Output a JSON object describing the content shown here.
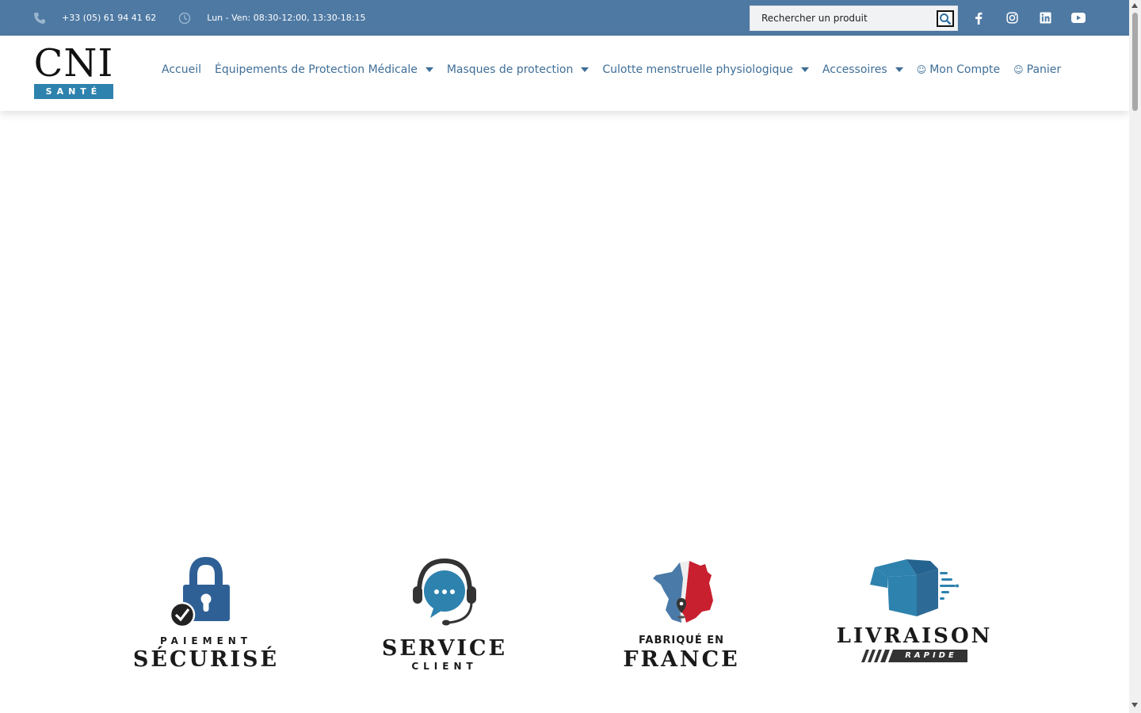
{
  "topbar": {
    "phone": "+33 (05) 61 94 41 62",
    "hours": "Lun - Ven: 08:30-12:00, 13:30-18:15",
    "search_placeholder": "Rechercher un produit",
    "icons": [
      "phone-icon",
      "clock-icon",
      "search-icon",
      "facebook-icon",
      "instagram-icon",
      "linkedin-icon",
      "youtube-icon"
    ]
  },
  "logo": {
    "main": "CNI",
    "sub": "SANTÉ"
  },
  "nav": {
    "items": [
      {
        "label": "Accueil",
        "dropdown": false
      },
      {
        "label": "Équipements de Protection Médicale",
        "dropdown": true
      },
      {
        "label": "Masques de protection",
        "dropdown": true
      },
      {
        "label": "Culotte menstruelle physiologique",
        "dropdown": true
      },
      {
        "label": "Accessoires",
        "dropdown": true
      },
      {
        "label": "Mon Compte",
        "dropdown": false
      },
      {
        "label": "Panier",
        "dropdown": false
      }
    ]
  },
  "features": [
    {
      "small": "PAIEMENT",
      "big": "SÉCURISÉ",
      "icon": "padlock-icon"
    },
    {
      "big": "SERVICE",
      "small": "CLIENT",
      "icon": "headset-icon"
    },
    {
      "small": "FABRIQUÉ EN",
      "big": "FRANCE",
      "icon": "france-map-icon"
    },
    {
      "big": "LIVRAISON",
      "small": "RAPIDE",
      "icon": "delivery-box-icon"
    }
  ],
  "colors": {
    "topbar": "#4e79a3",
    "nav_text": "#3f6e97",
    "accent": "#2e82ae",
    "dark": "#1a1a1a"
  }
}
